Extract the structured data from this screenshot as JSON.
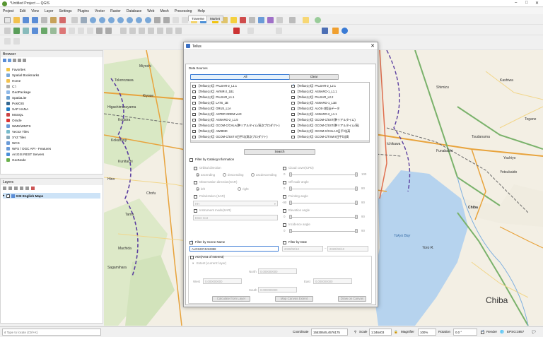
{
  "window": {
    "title": "*Untitled Project — QGIS"
  },
  "menu": [
    "Project",
    "Edit",
    "View",
    "Layer",
    "Settings",
    "Plugins",
    "Vector",
    "Raster",
    "Database",
    "Web",
    "Mesh",
    "Processing",
    "Help"
  ],
  "browser": {
    "title": "Browser",
    "items": [
      "Favorites",
      "Spatial Bookmarks",
      "Home",
      "C:\\",
      "GeoPackage",
      "SpatiaLite",
      "PostGIS",
      "SAP HANA",
      "MSSQL",
      "Oracle",
      "WMS/WMTS",
      "Vector Tiles",
      "XYZ Tiles",
      "WCS",
      "WFS / OGC API - Features",
      "ArcGIS REST Servers",
      "GeoNode"
    ]
  },
  "layers": {
    "title": "Layers",
    "items": [
      "GSI English Maps"
    ]
  },
  "map": {
    "labels": [
      "Miyoshi",
      "Tokorozawa",
      "Kiyose",
      "Higashimurayama",
      "Kodaira",
      "Kokubunji",
      "Kunitachi",
      "Hino",
      "Tama",
      "Machida",
      "Chofu",
      "Sagamihara",
      "Shimizu",
      "Kashiwa",
      "Ichikawa",
      "Funabashi",
      "Tsudanuma",
      "Yachiyo",
      "Tokyo Bay",
      "Chiba",
      "Yotsukaido",
      "Togane",
      "Yoro R.",
      "Chiba"
    ]
  },
  "dialog": {
    "title": "Tellus",
    "tabs": [
      "Traverse",
      "Market"
    ],
    "data_sources_label": "Data Sources",
    "all_button": "All",
    "clear_button": "Clear",
    "sources_left": [
      "【Tellus公式】PALSAR-2_L1.1",
      "【Tellus公式】AVNIR-2_1B1",
      "【Tellus公式】PALSAR_L1.1",
      "【Tellus公式】LATS_1B",
      "【Tellus公式】GRUS_L1A",
      "【Tellus公式】ASTER GDEM ver3",
      "【Tellus公式】ASNARO-2_L1.5",
      "【Tellus公式】GCOM-C/CHLA(準リアルタイム/高次プロダクト)",
      "【Tellus公式】AW3D30",
      "【Tellus公式】GCOM-C/SST 8日平均(高次プロダクト)"
    ],
    "sources_right": [
      "【Tellus公式】PALSAR-2_L2.1",
      "【Tellus公式】ASNARO-1_L1.1",
      "【Tellus公式】PALSAR_L2.2",
      "【Tellus公式】ASNARO-1_L1B",
      "【Tellus公式】ALOS-3相当データ",
      "【Tellus公式】ASNARO-2_L1.1",
      "【Tellus公式】GCOM-C/SST(準リアルタイム)",
      "【Tellus公式】GCOM-C/SST(準リアルタイム/高)",
      "【Tellus公式】GCOM-C/CHLA 8日平均(高",
      "【Tellus公式】GCOM-C/TSM 8日平均(高"
    ],
    "search_button": "Search",
    "filter_catalog": "Filter by Catalog Information",
    "orbital_direction": "Orbital direction",
    "ascending": "ascending",
    "descending": "descending",
    "ascdescending": "ascdescending",
    "cloud_cover": "Cloud cover(CPD)",
    "observation_direction": "Observation direction(SAR)",
    "off_nadir": "Off nadir angle",
    "left": "left",
    "right": "right",
    "polarization": "Polarization (SAR)",
    "polarization_value": "HH",
    "pointing_angle": "Pointing angle",
    "instrument_mode": "Instrument mode(SAR)",
    "instrument_placeholder": "Enter text",
    "elevation_angle": "Elevation angle",
    "incidence_angle": "Incidence angle",
    "zero": "0",
    "val100": "100",
    "val90": "90",
    "valm90": "-90",
    "filter_scene": "Filter by Scene Name",
    "scene_value": "ALOS2874222888",
    "filter_date": "Filter by Date",
    "date_from": "2020/02/10",
    "date_to": "2020/02/10",
    "aoi": "AOI(Area of Interest)",
    "extent": "Extent (current: layer)",
    "north": "North",
    "west": "West",
    "east": "East",
    "south": "South",
    "coord": "0.000000000",
    "calc_layer": "Calculate from Layer",
    "map_canvas": "Map Canvas Extent",
    "draw_canvas": "Draw on Canvas"
  },
  "status": {
    "locate_placeholder": "Type to locate (Ctrl+K)",
    "coordinate_label": "Coordinate",
    "coordinate_value": "15530645,4576175",
    "scale_label": "Scale",
    "scale_value": "1:346403",
    "magnifier_label": "Magnifier",
    "magnifier_value": "100%",
    "rotation_label": "Rotation",
    "rotation_value": "0.0 °",
    "render_label": "Render",
    "crs": "EPSG:3857"
  }
}
